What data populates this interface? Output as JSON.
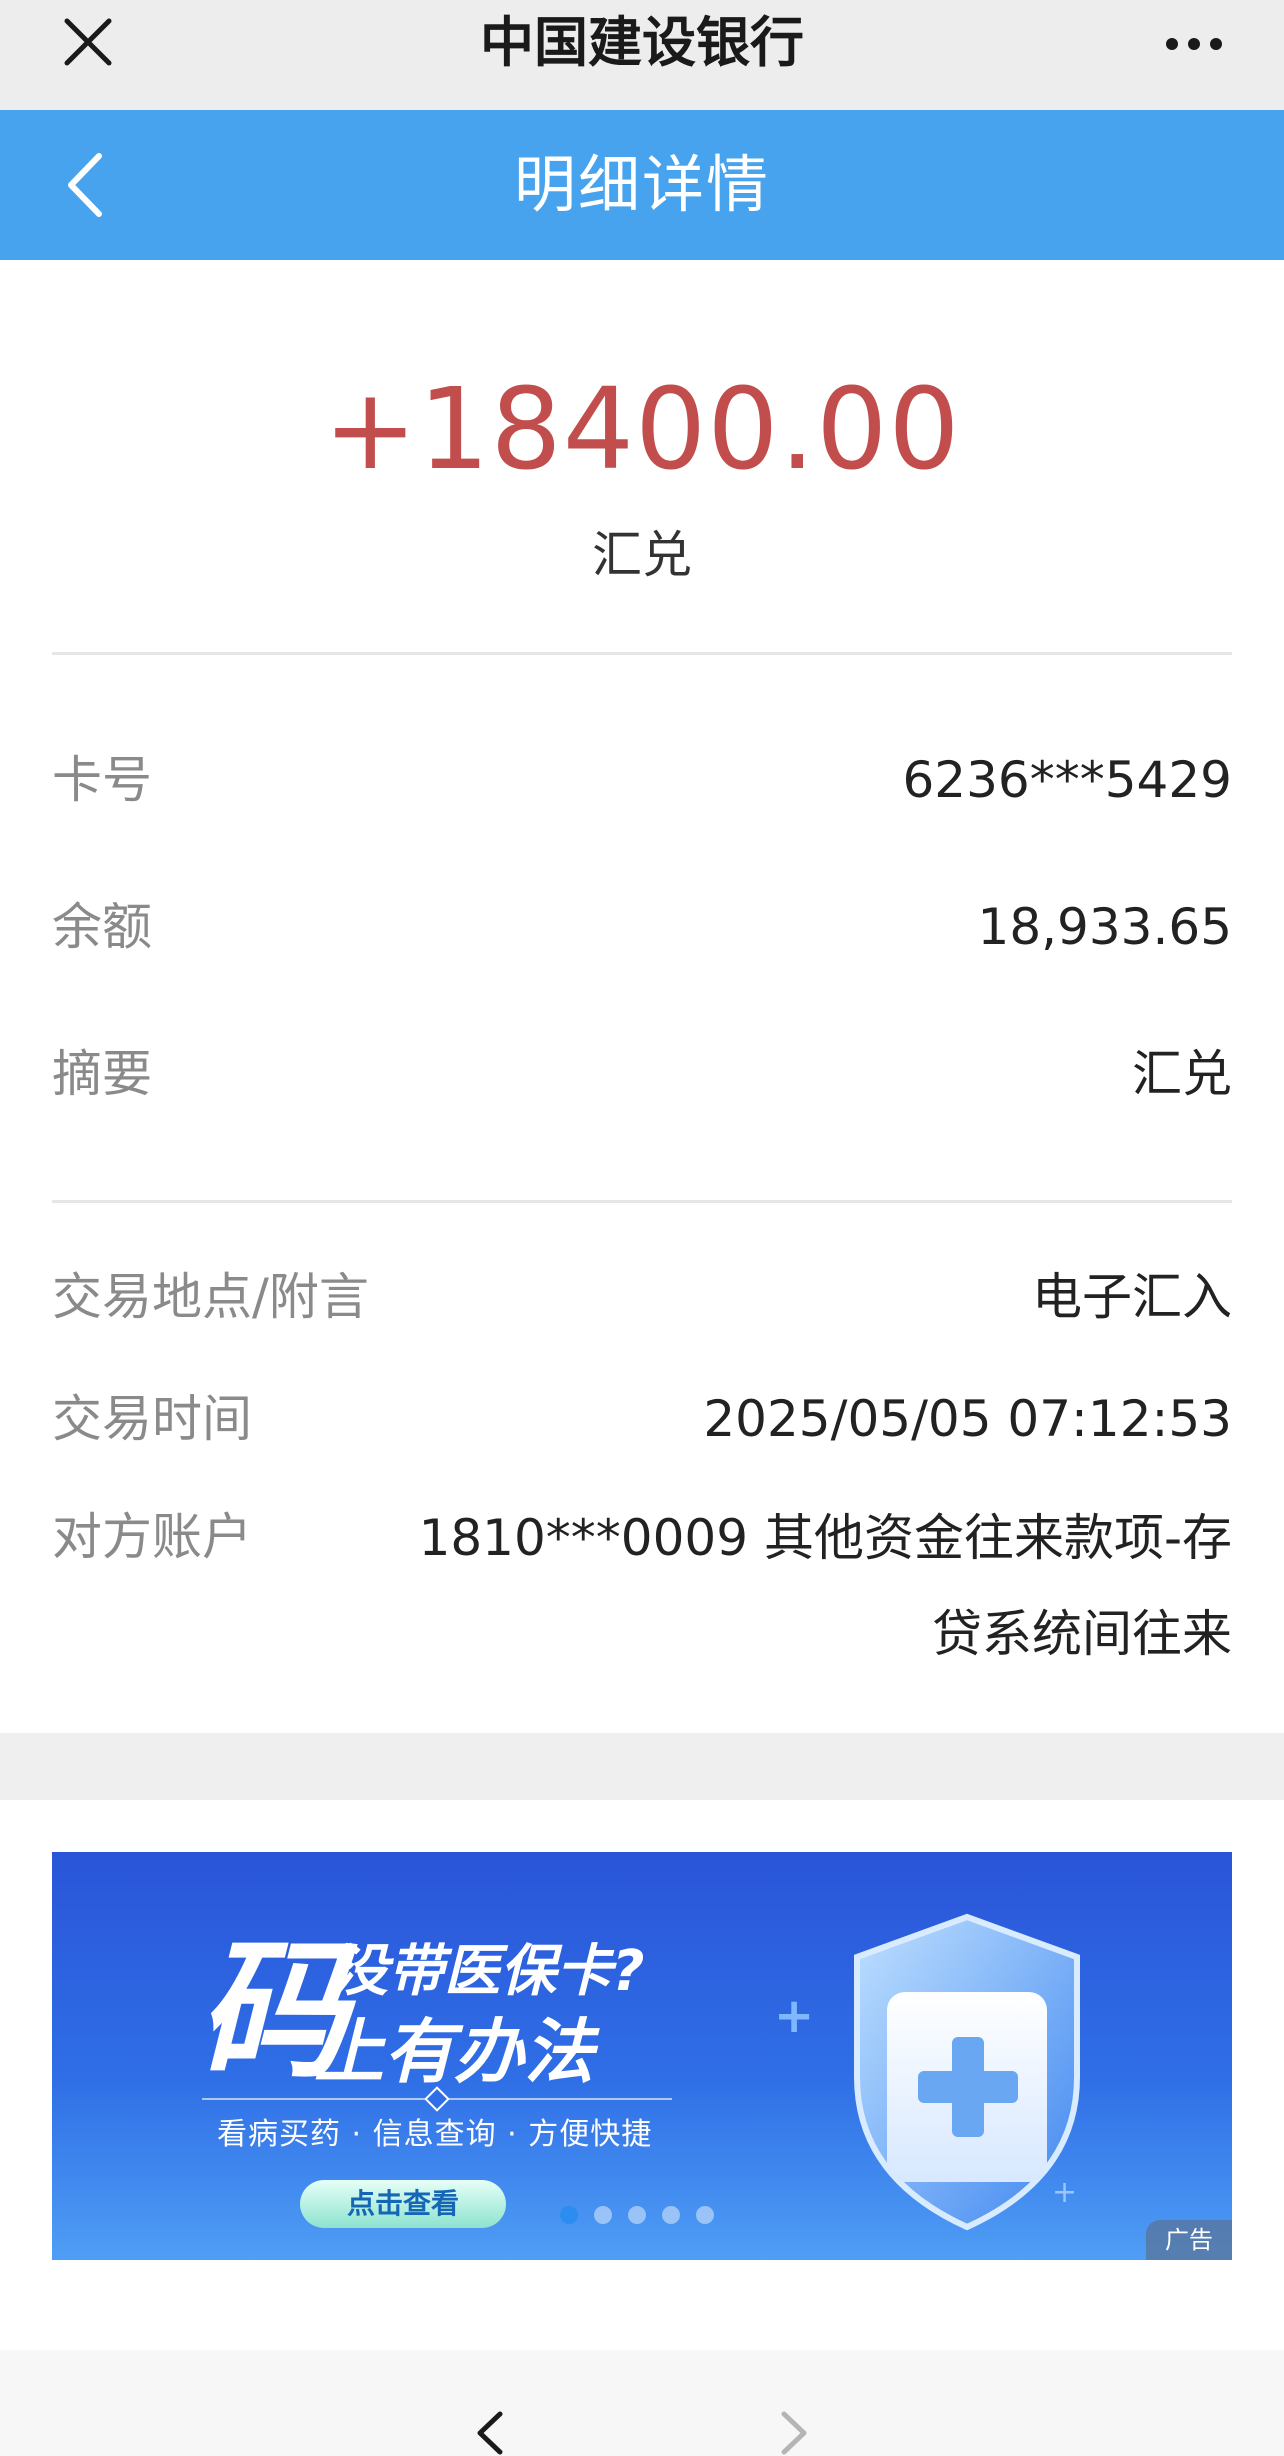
{
  "topbar": {
    "app_title": "中国建设银行"
  },
  "header": {
    "title": "明细详情"
  },
  "summary": {
    "amount": "+18400.00",
    "type": "汇兑"
  },
  "details": [
    {
      "label": "卡号",
      "value": "6236***5429"
    },
    {
      "label": "余额",
      "value": "18,933.65"
    },
    {
      "label": "摘要",
      "value": "汇兑"
    }
  ],
  "extra": [
    {
      "label": "交易地点/附言",
      "value": "电子汇入"
    },
    {
      "label": "交易时间",
      "value": "2025/05/05 07:12:53"
    },
    {
      "label": "对方账户",
      "value": "1810***0009  其他资金往来款项-存贷系统间往来"
    }
  ],
  "banner": {
    "big_char": "码",
    "line1": "没带医保卡?",
    "line2": "上有办法",
    "subline": "看病买药 · 信息查询 · 方便快捷",
    "cta": "点击查看",
    "ad_tag": "广告",
    "pages": 5,
    "active_page": 1
  },
  "colors": {
    "header_bg": "#48a3ee",
    "amount_color": "#c14e4c",
    "banner_bg": "#2f6ee6"
  },
  "icons": {
    "close": "close-icon",
    "more": "more-icon",
    "back": "chevron-left-icon",
    "nav_back": "chevron-left-icon",
    "nav_forward": "chevron-right-icon"
  }
}
